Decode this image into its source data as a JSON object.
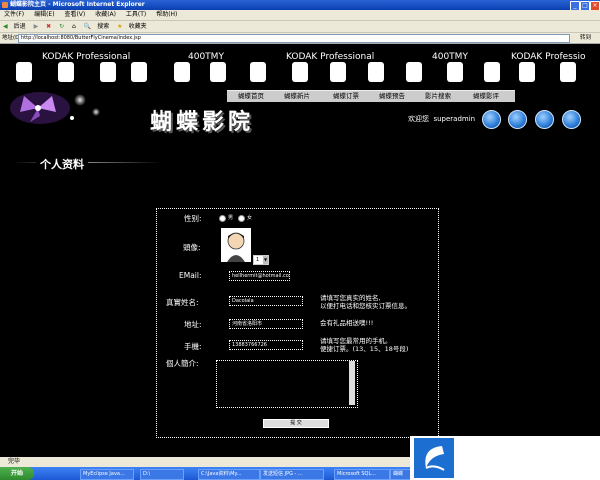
{
  "window": {
    "title": "蝴蝶影院主页 - Microsoft Internet Explorer"
  },
  "menu": [
    "文件(F)",
    "编辑(E)",
    "查看(V)",
    "收藏(A)",
    "工具(T)",
    "帮助(H)"
  ],
  "toolbar": {
    "back": "后退",
    "search": "搜索",
    "favorites": "收藏夹"
  },
  "address": {
    "label": "地址(D)",
    "url": "http://localhost:8080/ButterFlyCinema/index.jsp",
    "go": "转到"
  },
  "film_texts": [
    "KODAK Professional",
    "400TMY",
    "KODAK Professional",
    "400TMY",
    "KODAK Professio"
  ],
  "nav": [
    "蝴蝶首页",
    "蝴蝶新片",
    "蝴蝶订票",
    "蝴蝶预告",
    "影片搜索",
    "蝴蝶影评"
  ],
  "site_title": "蝴蝶影院",
  "welcome": {
    "text": "欢迎您",
    "user": "superadmin"
  },
  "section": {
    "title": "个人资料"
  },
  "form": {
    "gender_label": "性别:",
    "gender_male": "男",
    "gender_female": "女",
    "avatar_label": "頭像:",
    "avatar_select": "1",
    "email_label": "EMail:",
    "email_value": "hellhermit@hotmail.com",
    "name_label": "真實姓名:",
    "name_value": "Dacoiala",
    "name_hint1": "请填写您真实的姓名,",
    "name_hint2": "以便打电话和您核实订票信息。",
    "addr_label": "地址:",
    "addr_value": "河南省洛阳市",
    "addr_hint": "会有礼品相送噢!!!",
    "phone_label": "手機:",
    "phone_value": "13883766726",
    "phone_hint1": "请填写您最常用的手机。",
    "phone_hint2": "便捷订票。(13、15、18号段)",
    "bio_label": "個人簡介:",
    "submit": "提 交"
  },
  "status": {
    "text": "完毕"
  },
  "taskbar": {
    "start": "开始",
    "tasks": [
      "MyEclipse Java...",
      "D:\\",
      "C:\\Java资料\\My...",
      "发送短信 JPG - ...",
      "Microsoft SQL...",
      "蝴蝶"
    ]
  },
  "colors": {
    "accent": "#2a7bd6",
    "film": "#000000",
    "nav": "#cccccc"
  }
}
